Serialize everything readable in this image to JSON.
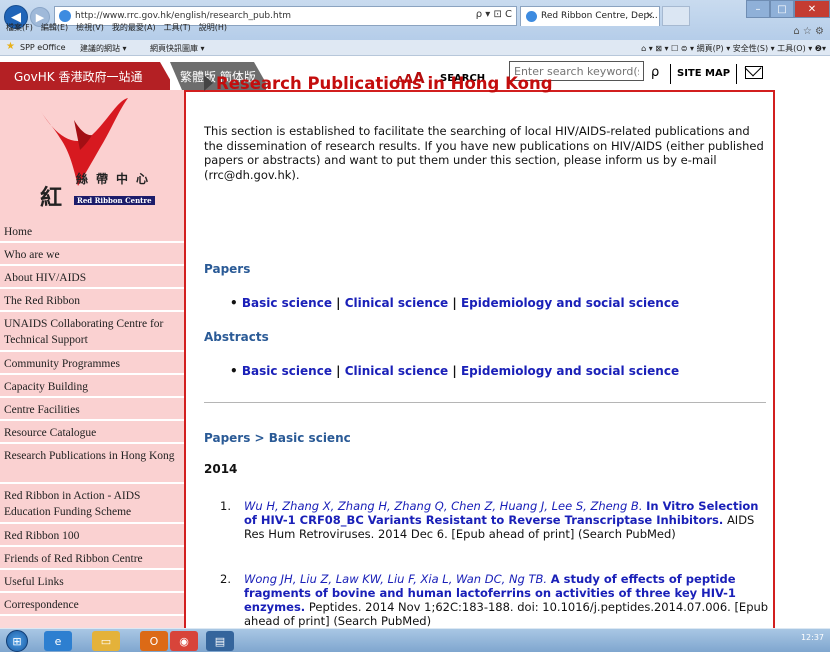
{
  "browser": {
    "address": "http://www.rrc.gov.hk/english/research_pub.htm",
    "address_tools": "ρ ▾ ⊡ C",
    "tab_title": "Red Ribbon Centre, Dep...",
    "tab_close": "×",
    "menu": [
      "檔案(F)",
      "編輯(E)",
      "檢視(V)",
      "我的最愛(A)",
      "工具(T)",
      "說明(H)"
    ],
    "favorites": [
      "SPP eOffice",
      "建議的網站 ▾",
      "網頁快訊圖庫 ▾"
    ],
    "command_bar": "⌂ ▾ ⊠ ▾ ☐ ⊜ ▾ 網頁(P) ▾ 安全性(S) ▾ 工具(O) ▾ ❷▾",
    "corner_icons": "⌂ ☆ ⚙"
  },
  "header": {
    "govhk": "GovHK 香港政府一站通",
    "lang": "繁體版  簡体版",
    "font_a1": "A",
    "font_a2": "A",
    "font_a3": "A",
    "search_label": "SEARCH",
    "search_placeholder": "Enter search keyword(s)",
    "sitemap": "SITE MAP"
  },
  "logo": {
    "main": "紅",
    "cn": "絲帶中心",
    "en": "Red Ribbon Centre"
  },
  "nav": [
    "Home",
    "Who are we",
    "About HIV/AIDS",
    "The Red Ribbon",
    "UNAIDS Collaborating Centre for Technical Support",
    "Community Programmes",
    "Capacity Building",
    "Centre Facilities",
    "Resource Catalogue",
    "Research Publications in Hong Kong",
    "Red Ribbon in Action - AIDS Education Funding Scheme",
    "Red Ribbon 100",
    "Friends of Red Ribbon Centre",
    "Useful Links",
    "Correspondence"
  ],
  "content": {
    "title": "Research Publications in Hong Kong",
    "intro": "This section is established to facilitate the searching of local HIV/AIDS-related publications and the dissemination of research results. If you have new publications on HIV/AIDS (either published papers or abstracts) and want to put them under this section, please inform us by e-mail (rrc@dh.gov.hk).",
    "papers_heading": "Papers",
    "abstracts_heading": "Abstracts",
    "bullet": "•",
    "link_basic": "Basic science",
    "link_clinical": "Clinical science",
    "link_epi": "Epidemiology and social science",
    "pipe": " | ",
    "breadcrumb": "Papers > Basic scienc",
    "year": "2014",
    "pubs": [
      {
        "num": "1.",
        "authors": "Wu H, Zhang X, Zhang H, Zhang Q, Chen Z, Huang J, Lee S, Zheng B.",
        "title": "In Vitro Selection of HIV-1 CRF08_BC Variants Resistant to Reverse Transcriptase Inhibitors.",
        "rest": "AIDS Res Hum Retroviruses. 2014 Dec 6. [Epub ahead of print] (Search PubMed)"
      },
      {
        "num": "2.",
        "authors": "Wong JH, Liu Z, Law KW, Liu F, Xia L, Wan DC, Ng TB.",
        "title": "A study of effects of peptide fragments of bovine and human lactoferrins on activities of three key HIV-1 enzymes.",
        "rest": "Peptides. 2014 Nov 1;62C:183-188. doi: 10.1016/j.peptides.2014.07.006. [Epub ahead of print] (Search PubMed)"
      }
    ]
  },
  "taskbar": {
    "time": "12:37"
  }
}
